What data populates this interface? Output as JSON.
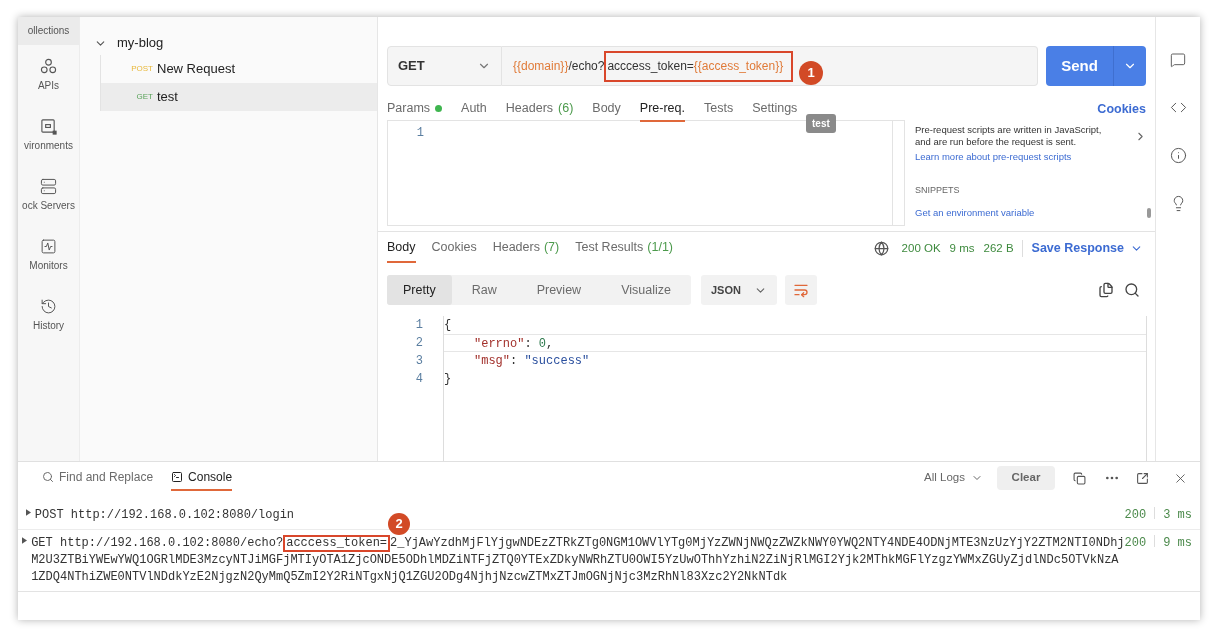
{
  "nav_rail": [
    {
      "kind": "collections",
      "label": "ollections",
      "selected": true
    },
    {
      "kind": "apis",
      "label": "APIs",
      "selected": false
    },
    {
      "kind": "environments",
      "label": "vironments",
      "selected": false
    },
    {
      "kind": "mock_servers",
      "label": "ock Servers",
      "selected": false
    },
    {
      "kind": "monitors",
      "label": "Monitors",
      "selected": false
    },
    {
      "kind": "history",
      "label": "History",
      "selected": false
    }
  ],
  "sidebar": {
    "collection": {
      "name": "my-blog",
      "expanded": true,
      "children": [
        {
          "method": "POST",
          "name": "New Request",
          "selected": false
        },
        {
          "method": "GET",
          "name": "test",
          "selected": true
        }
      ]
    }
  },
  "request": {
    "method": "GET",
    "url_parts": [
      {
        "text": "{{domain}}",
        "variable": true,
        "annotated": false
      },
      {
        "text": "/echo?",
        "variable": false,
        "annotated": false
      },
      {
        "text": "acccess_token=",
        "variable": false,
        "annotated": true
      },
      {
        "text": "{{access_token}}",
        "variable": true,
        "annotated": true
      }
    ],
    "annotation_number": "1",
    "send": "Send"
  },
  "request_tabs": [
    {
      "label": "Params",
      "dot": true,
      "selected": false
    },
    {
      "label": "Auth",
      "dot": false,
      "selected": false
    },
    {
      "label": "Headers",
      "count": "(6)",
      "dot": false,
      "selected": false
    },
    {
      "label": "Body",
      "dot": false,
      "selected": false
    },
    {
      "label": "Pre-req.",
      "dot": false,
      "selected": true
    },
    {
      "label": "Tests",
      "dot": false,
      "selected": false
    },
    {
      "label": "Settings",
      "dot": false,
      "selected": false
    }
  ],
  "tooltip": "test",
  "cookies_link": "Cookies",
  "editor": {
    "line_numbers": [
      "1"
    ]
  },
  "help": {
    "text": "Pre-request scripts are written in JavaScript, and are run before the request is sent.",
    "link": "Learn more about pre-request scripts",
    "snippets_title": "SNIPPETS",
    "snippets": [
      "Get an environment variable"
    ]
  },
  "response": {
    "tabs": [
      {
        "label": "Body",
        "selected": true
      },
      {
        "label": "Cookies",
        "selected": false
      },
      {
        "label": "Headers",
        "count": "(7)",
        "selected": false
      },
      {
        "label": "Test Results",
        "count": "(1/1)",
        "selected": false
      }
    ],
    "status": "200 OK",
    "time": "9 ms",
    "size": "262 B",
    "save": "Save Response",
    "view_modes": [
      {
        "label": "Pretty",
        "selected": true
      },
      {
        "label": "Raw",
        "selected": false
      },
      {
        "label": "Preview",
        "selected": false
      },
      {
        "label": "Visualize",
        "selected": false
      }
    ],
    "format": "JSON",
    "lines": [
      {
        "number": "1",
        "indented": false,
        "tokens": [
          {
            "kind": "punct",
            "text": "{"
          }
        ]
      },
      {
        "number": "2",
        "indented": true,
        "tokens": [
          {
            "kind": "key",
            "text": "\"errno\""
          },
          {
            "kind": "punct",
            "text": ": "
          },
          {
            "kind": "number",
            "text": "0"
          },
          {
            "kind": "punct",
            "text": ","
          }
        ]
      },
      {
        "number": "3",
        "indented": true,
        "tokens": [
          {
            "kind": "key",
            "text": "\"msg\""
          },
          {
            "kind": "punct",
            "text": ": "
          },
          {
            "kind": "string",
            "text": "\"success\""
          }
        ]
      },
      {
        "number": "4",
        "indented": false,
        "tokens": [
          {
            "kind": "punct",
            "text": "}"
          }
        ]
      }
    ]
  },
  "console": {
    "tabs": [
      {
        "kind": "find",
        "label": "Find and Replace",
        "selected": false
      },
      {
        "kind": "console",
        "label": "Console",
        "selected": true
      }
    ],
    "filter": "All Logs",
    "clear": "Clear",
    "logs": [
      {
        "lines": [
          [
            {
              "text": "POST http://192.168.0.102:8080/login",
              "annotated": false
            }
          ]
        ],
        "status": "200",
        "time": "3 ms"
      },
      {
        "lines": [
          [
            {
              "text": "GET http://192.168.0.102:8080/echo?",
              "annotated": false
            },
            {
              "text": "acccess_token=",
              "annotated": true
            },
            {
              "text": "2_YjAwYzdhMjFlYjgwNDEzZTRkZTg0NGM1OWVlYTg0MjYzZWNjNWQzZWZkNWY0YWQ2NTY4NDE4ODNjMTE3NzUzYjY2ZTM2NTI0NDhj",
              "annotated": false
            }
          ],
          [
            {
              "text": "M2U3ZTBiYWEwYWQ1OGRlMDE3MzcyNTJiMGFjMTIyOTA1ZjcONDE5ODhlMDZiNTFjZTQ0YTExZDkyNWRhZTU0OWI5YzUwOThhYzhiN2ZiNjRlMGI2Yjk2MThkMGFlYzgzYWMxZGUyZjdlNDc5OTVkNzA",
              "annotated": false
            }
          ],
          [
            {
              "text": "1ZDQ4NThiZWE0NTVlNDdkYzE2NjgzN2QyMmQ5ZmI2Y2RiNTgxNjQ1ZGU2ODg4NjhjNzcwZTMxZTJmOGNjNjc3MzRhNl83Xzc2Y2NkNTdk",
              "annotated": false
            }
          ]
        ],
        "status": "200",
        "time": "9 ms",
        "annotation_number": "2"
      }
    ]
  }
}
